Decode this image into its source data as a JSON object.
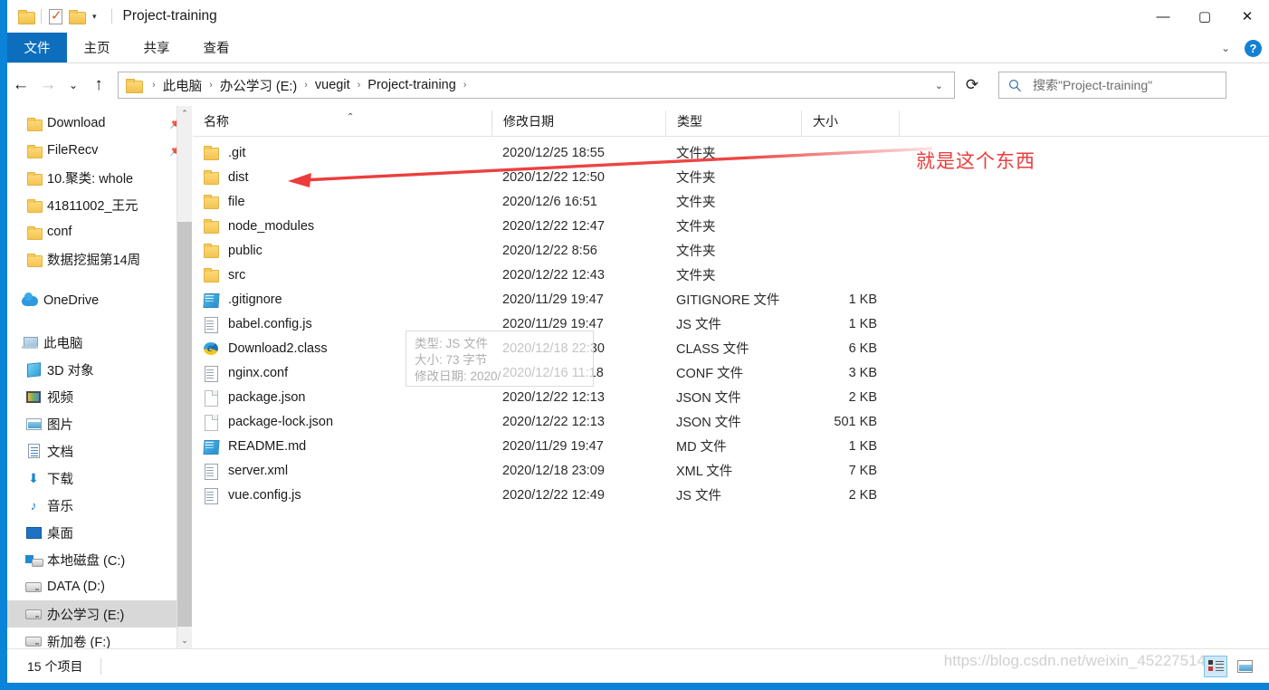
{
  "window": {
    "title": "Project-training",
    "minimize_label": "—",
    "maximize_label": "▢",
    "close_label": "✕"
  },
  "quick_access": {
    "folder_icon": "folder-icon",
    "properties_icon": "properties-checkbox-icon",
    "new_folder_icon": "new-folder-icon",
    "dropdown_label": "▾"
  },
  "ribbon": {
    "tabs": [
      {
        "label": "文件",
        "active": true
      },
      {
        "label": "主页",
        "active": false
      },
      {
        "label": "共享",
        "active": false
      },
      {
        "label": "查看",
        "active": false
      }
    ],
    "collapse_label": "⌄",
    "help_label": "?"
  },
  "nav": {
    "back_label": "←",
    "forward_label": "→",
    "recent_label": "⌄",
    "up_label": "↑",
    "refresh_label": "⟳",
    "address_dropdown": "⌄",
    "breadcrumbs": [
      "此电脑",
      "办公学习 (E:)",
      "vuegit",
      "Project-training"
    ],
    "separator": "›"
  },
  "search": {
    "placeholder": "搜索\"Project-training\"",
    "icon": "search-icon"
  },
  "sidebar": {
    "items": [
      {
        "label": "Download",
        "icon": "folder-icon",
        "pinned": true,
        "indent": 2,
        "selected": false
      },
      {
        "label": "FileRecv",
        "icon": "folder-icon",
        "pinned": true,
        "indent": 2,
        "selected": false
      },
      {
        "label": "10.聚类: whole",
        "icon": "folder-icon",
        "pinned": false,
        "indent": 2,
        "selected": false
      },
      {
        "label": "41811002_王元",
        "icon": "folder-icon",
        "pinned": false,
        "indent": 2,
        "selected": false
      },
      {
        "label": "conf",
        "icon": "folder-icon",
        "pinned": false,
        "indent": 2,
        "selected": false
      },
      {
        "label": "数据挖掘第14周",
        "icon": "folder-icon",
        "pinned": false,
        "indent": 2,
        "selected": false
      },
      {
        "label": "OneDrive",
        "icon": "cloud-icon",
        "pinned": false,
        "indent": 1,
        "selected": false,
        "gap_before": true
      },
      {
        "label": "此电脑",
        "icon": "this-pc-icon",
        "pinned": false,
        "indent": 1,
        "selected": false,
        "gap_before": true
      },
      {
        "label": "3D 对象",
        "icon": "3d-objects-icon",
        "pinned": false,
        "indent": 2,
        "selected": false
      },
      {
        "label": "视频",
        "icon": "videos-icon",
        "pinned": false,
        "indent": 2,
        "selected": false
      },
      {
        "label": "图片",
        "icon": "pictures-icon",
        "pinned": false,
        "indent": 2,
        "selected": false
      },
      {
        "label": "文档",
        "icon": "documents-icon",
        "pinned": false,
        "indent": 2,
        "selected": false
      },
      {
        "label": "下载",
        "icon": "downloads-icon",
        "pinned": false,
        "indent": 2,
        "selected": false
      },
      {
        "label": "音乐",
        "icon": "music-icon",
        "pinned": false,
        "indent": 2,
        "selected": false
      },
      {
        "label": "桌面",
        "icon": "desktop-icon",
        "pinned": false,
        "indent": 2,
        "selected": false
      },
      {
        "label": "本地磁盘 (C:)",
        "icon": "windows-drive-icon",
        "pinned": false,
        "indent": 2,
        "selected": false
      },
      {
        "label": "DATA (D:)",
        "icon": "drive-icon",
        "pinned": false,
        "indent": 2,
        "selected": false
      },
      {
        "label": "办公学习 (E:)",
        "icon": "drive-icon",
        "pinned": false,
        "indent": 2,
        "selected": true
      },
      {
        "label": "新加卷 (F:)",
        "icon": "drive-icon",
        "pinned": false,
        "indent": 2,
        "selected": false
      }
    ],
    "pin_icon": "pin-icon",
    "scroll_up_label": "⌃",
    "scroll_down_label": "⌄"
  },
  "file_list": {
    "columns": [
      "名称",
      "修改日期",
      "类型",
      "大小"
    ],
    "sort_indicator": "⌃",
    "rows": [
      {
        "name": ".git",
        "modified": "2020/12/25 18:55",
        "type": "文件夹",
        "size": "",
        "icon": "folder-icon"
      },
      {
        "name": "dist",
        "modified": "2020/12/22 12:50",
        "type": "文件夹",
        "size": "",
        "icon": "folder-icon"
      },
      {
        "name": "file",
        "modified": "2020/12/6 16:51",
        "type": "文件夹",
        "size": "",
        "icon": "folder-icon"
      },
      {
        "name": "node_modules",
        "modified": "2020/12/22 12:47",
        "type": "文件夹",
        "size": "",
        "icon": "folder-icon"
      },
      {
        "name": "public",
        "modified": "2020/12/22 8:56",
        "type": "文件夹",
        "size": "",
        "icon": "folder-icon"
      },
      {
        "name": "src",
        "modified": "2020/12/22 12:43",
        "type": "文件夹",
        "size": "",
        "icon": "folder-icon"
      },
      {
        "name": ".gitignore",
        "modified": "2020/11/29 19:47",
        "type": "GITIGNORE 文件",
        "size": "1 KB",
        "icon": "blue-file-icon"
      },
      {
        "name": "babel.config.js",
        "modified": "2020/11/29 19:47",
        "type": "JS 文件",
        "size": "1 KB",
        "icon": "text-file-icon"
      },
      {
        "name": "Download2.class",
        "modified": "2020/12/18 22:30",
        "type": "CLASS 文件",
        "size": "6 KB",
        "icon": "internet-explorer-icon"
      },
      {
        "name": "nginx.conf",
        "modified": "2020/12/16 11:18",
        "type": "CONF 文件",
        "size": "3 KB",
        "icon": "text-file-icon"
      },
      {
        "name": "package.json",
        "modified": "2020/12/22 12:13",
        "type": "JSON 文件",
        "size": "2 KB",
        "icon": "blank-file-icon"
      },
      {
        "name": "package-lock.json",
        "modified": "2020/12/22 12:13",
        "type": "JSON 文件",
        "size": "501 KB",
        "icon": "blank-file-icon"
      },
      {
        "name": "README.md",
        "modified": "2020/11/29 19:47",
        "type": "MD 文件",
        "size": "1 KB",
        "icon": "blue-file-icon"
      },
      {
        "name": "server.xml",
        "modified": "2020/12/18 23:09",
        "type": "XML 文件",
        "size": "7 KB",
        "icon": "text-file-icon"
      },
      {
        "name": "vue.config.js",
        "modified": "2020/12/22 12:49",
        "type": "JS 文件",
        "size": "2 KB",
        "icon": "text-file-icon"
      }
    ]
  },
  "tooltip": {
    "line1": "类型: JS 文件",
    "line2": "大小: 73 字节",
    "line3": "修改日期: 2020/"
  },
  "annotation": {
    "text": "就是这个东西",
    "color": "#ec3c3c"
  },
  "status": {
    "item_count": "15 个项目",
    "view_details_icon": "details-view-icon",
    "view_thumbnails_icon": "thumbnails-view-icon"
  },
  "watermark": {
    "text": "https://blog.csdn.net/weixin_45227514"
  }
}
